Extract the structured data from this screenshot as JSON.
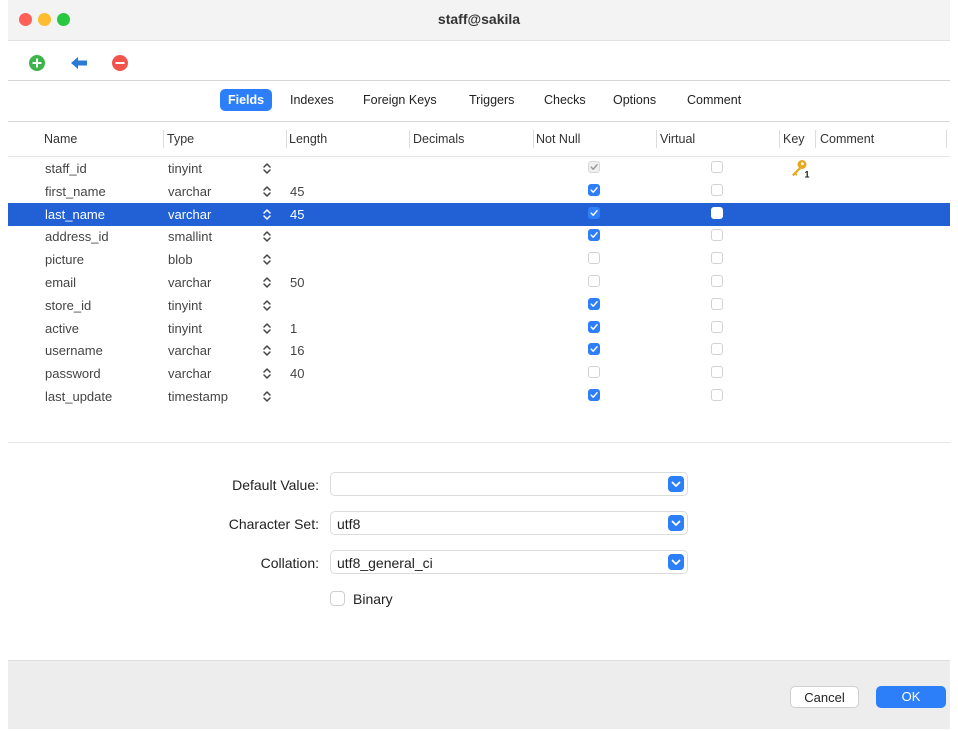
{
  "window": {
    "title": "staff@sakila"
  },
  "toolbar": {
    "add_icon": "plus-circle-icon",
    "back_icon": "arrow-left-icon",
    "remove_icon": "minus-circle-icon"
  },
  "tabs": [
    {
      "label": "Fields",
      "active": true
    },
    {
      "label": "Indexes",
      "active": false
    },
    {
      "label": "Foreign Keys",
      "active": false
    },
    {
      "label": "Triggers",
      "active": false
    },
    {
      "label": "Checks",
      "active": false
    },
    {
      "label": "Options",
      "active": false
    },
    {
      "label": "Comment",
      "active": false
    }
  ],
  "columns": [
    "Name",
    "Type",
    "Length",
    "Decimals",
    "Not Null",
    "Virtual",
    "Key",
    "Comment"
  ],
  "rows": [
    {
      "name": "staff_id",
      "type": "tinyint",
      "length": "",
      "not_null": true,
      "virtual": false,
      "key": "1",
      "selected": false
    },
    {
      "name": "first_name",
      "type": "varchar",
      "length": "45",
      "not_null": true,
      "virtual": false,
      "key": "",
      "selected": false
    },
    {
      "name": "last_name",
      "type": "varchar",
      "length": "45",
      "not_null": true,
      "virtual": false,
      "key": "",
      "selected": true
    },
    {
      "name": "address_id",
      "type": "smallint",
      "length": "",
      "not_null": true,
      "virtual": false,
      "key": "",
      "selected": false
    },
    {
      "name": "picture",
      "type": "blob",
      "length": "",
      "not_null": false,
      "virtual": false,
      "key": "",
      "selected": false
    },
    {
      "name": "email",
      "type": "varchar",
      "length": "50",
      "not_null": false,
      "virtual": false,
      "key": "",
      "selected": false
    },
    {
      "name": "store_id",
      "type": "tinyint",
      "length": "",
      "not_null": true,
      "virtual": false,
      "key": "",
      "selected": false
    },
    {
      "name": "active",
      "type": "tinyint",
      "length": "1",
      "not_null": true,
      "virtual": false,
      "key": "",
      "selected": false
    },
    {
      "name": "username",
      "type": "varchar",
      "length": "16",
      "not_null": true,
      "virtual": false,
      "key": "",
      "selected": false
    },
    {
      "name": "password",
      "type": "varchar",
      "length": "40",
      "not_null": false,
      "virtual": false,
      "key": "",
      "selected": false
    },
    {
      "name": "last_update",
      "type": "timestamp",
      "length": "",
      "not_null": true,
      "virtual": false,
      "key": "",
      "selected": false
    }
  ],
  "properties": {
    "default_value": {
      "label": "Default Value:",
      "value": ""
    },
    "character_set": {
      "label": "Character Set:",
      "value": "utf8"
    },
    "collation": {
      "label": "Collation:",
      "value": "utf8_general_ci"
    },
    "binary": {
      "label": "Binary",
      "checked": false
    }
  },
  "footer": {
    "cancel_label": "Cancel",
    "ok_label": "OK"
  },
  "colors": {
    "accent": "#2d7ff9",
    "selection": "#2260d6",
    "add": "#28c840",
    "back": "#2a7bd6",
    "remove": "#f2544c"
  }
}
